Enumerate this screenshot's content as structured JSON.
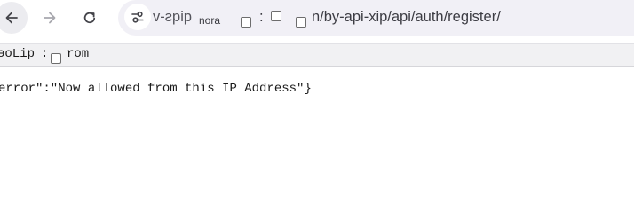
{
  "browser": {
    "nav": {
      "back_icon": "arrow-left-icon",
      "forward_icon": "arrow-right-icon",
      "reload_icon": "reload-icon"
    },
    "omnibox": {
      "site_info_icon": "tune-icon",
      "fragment_mirrored": "qiqs-v",
      "fragment_small": "nora",
      "fragment_colon": ":",
      "url_visible": "n/by-api-xip/api/auth/register/"
    }
  },
  "viewer": {
    "left_label": "ɘoLip",
    "separator": ":",
    "right_label": "rom"
  },
  "response": {
    "text": "error\":\"Now allowed from this IP Address\"}"
  },
  "colors": {
    "toolbar_bg": "#ffffff",
    "omnibox_bg": "#f1f0f6",
    "viewer_bar_bg": "#f1f1f3",
    "text": "#1a1a1a"
  }
}
